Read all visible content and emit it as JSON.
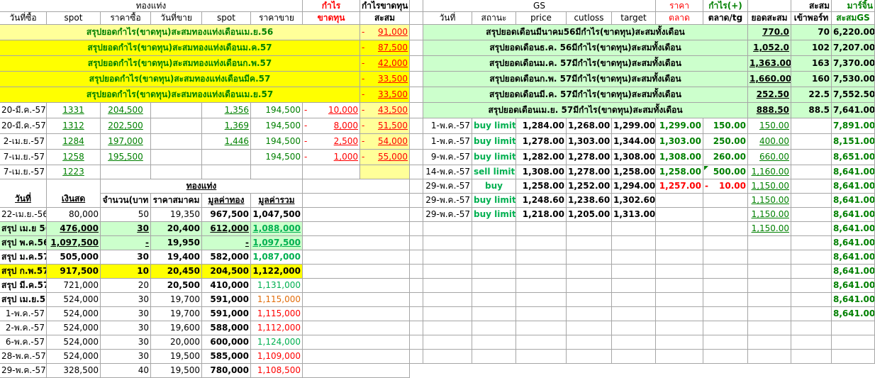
{
  "left": {
    "header1": {
      "group": "ทองแท่ง",
      "profit": "กำไร",
      "cum": "กำไรขาดทุน"
    },
    "header2": {
      "date": "วันที่ซื้อ",
      "spot1": "spot",
      "buy_price": "ราคาซื้อ",
      "sell_date": "วันที่ขาย",
      "spot2": "spot",
      "sell_price": "ราคาขาย",
      "loss": "ขาดทุน",
      "accum": "สะสม"
    },
    "summaries": [
      {
        "label": "สรุปยอดกำไร(ขาดทุน)สะสมทองแท่งเดือนเม.ย.56",
        "sign": "-",
        "value": "91,000"
      },
      {
        "label": "สรุปยอดกำไร(ขาดทุน)สะสมทองแท่งเดือนม.ค.57",
        "sign": "-",
        "value": "87,500"
      },
      {
        "label": "สรุปยอดกำไร(ขาดทุน)สะสมทองแท่งเดือนก.พ.57",
        "sign": "-",
        "value": "42,000"
      },
      {
        "label": "สรุปยอดกำไร(ขาดทุน)สะสมทองแท่งเดือนมีค.57",
        "sign": "-",
        "value": "33,500"
      },
      {
        "label": "สรุปยอดกำไร(ขาดทุน)สะสมทองแท่งเดือนเม.ย.57",
        "sign": "-",
        "value": "33,500"
      }
    ],
    "trades": [
      {
        "date": "20-มี.ค.-57",
        "spot": "1331",
        "buy": "204,500",
        "sell_date": "",
        "spot2": "1,356",
        "sell": "194,500",
        "sign": "-",
        "profit": "10,000",
        "sign2": "-",
        "accum": "43,500"
      },
      {
        "date": "20-มี.ค.-57",
        "spot": "1312",
        "buy": "202,500",
        "sell_date": "",
        "spot2": "1,369",
        "sell": "194,500",
        "sign": "-",
        "profit": "8,000",
        "sign2": "-",
        "accum": "51,500"
      },
      {
        "date": "2-เม.ย.-57",
        "spot": "1284",
        "buy": "197,000",
        "sell_date": "",
        "spot2": "1,446",
        "sell": "194,500",
        "sign": "-",
        "profit": "2,500",
        "sign2": "-",
        "accum": "54,000"
      },
      {
        "date": "7-เม.ย.-57",
        "spot": "1258",
        "buy": "195,500",
        "sell_date": "",
        "spot2": "",
        "sell": "194,500",
        "sign": "-",
        "profit": "1,000",
        "sign2": "-",
        "accum": "55,000"
      },
      {
        "date": "7-เม.ย.-57",
        "spot": "1223",
        "buy": "",
        "sell_date": "",
        "spot2": "",
        "sell": "",
        "sign": "",
        "profit": "",
        "sign2": "",
        "accum": ""
      }
    ],
    "section2": {
      "title": "ทองแท่ง",
      "headers": {
        "date": "วันที่",
        "cash": "เงินสด",
        "qty": "จำนวน(บาท",
        "assoc": "ราคาสมาคม",
        "gold_value": "มูลค่าทอง",
        "total": "มูลค่ารวม"
      },
      "rows": [
        {
          "date": "22-เม.ย.-56",
          "cash": "80,000",
          "qty": "50",
          "assoc": "19,350",
          "gold": "967,500",
          "total": "1,047,500",
          "style": "n"
        },
        {
          "date": "สรุป เม.ย 56",
          "cash": "476,000",
          "qty": "30",
          "assoc": "20,400",
          "gold": "612,000",
          "total": "1,088,000",
          "style": "green"
        },
        {
          "date": "สรุป พ.ค.56",
          "cash": "1,097,500",
          "qty": "-",
          "assoc": "19,950",
          "gold": "-",
          "total": "1,097,500",
          "style": "green"
        },
        {
          "date": "สรุป ม.ค.57",
          "cash": "505,000",
          "qty": "30",
          "assoc": "19,400",
          "gold": "582,000",
          "total": "1,087,000",
          "style": "s1"
        },
        {
          "date": "สรุป ก.พ.57",
          "cash": "917,500",
          "qty": "10",
          "assoc": "20,450",
          "gold": "204,500",
          "total": "1,122,000",
          "style": "yellow"
        },
        {
          "date": "สรุป มี.ค.57",
          "cash": "721,000",
          "qty": "20",
          "assoc": "20,500",
          "gold": "410,000",
          "total": "1,131,000",
          "style": "s2"
        },
        {
          "date": "สรุป เม.ย.57",
          "cash": "524,000",
          "qty": "30",
          "assoc": "19,700",
          "gold": "591,000",
          "total": "1,115,000",
          "style": "s3"
        },
        {
          "date": "1-พ.ค.-57",
          "cash": "524,000",
          "qty": "30",
          "assoc": "19,700",
          "gold": "591,000",
          "total": "1,115,000",
          "style": "red"
        },
        {
          "date": "2-พ.ค.-57",
          "cash": "524,000",
          "qty": "30",
          "assoc": "19,600",
          "gold": "588,000",
          "total": "1,112,000",
          "style": "red"
        },
        {
          "date": "6-พ.ค.-57",
          "cash": "524,000",
          "qty": "30",
          "assoc": "20,000",
          "gold": "600,000",
          "total": "1,124,000",
          "style": "grn"
        },
        {
          "date": "28-พ.ค.-57",
          "cash": "524,000",
          "qty": "30",
          "assoc": "19,500",
          "gold": "585,000",
          "total": "1,109,000",
          "style": "red"
        },
        {
          "date": "29-พ.ค.-57",
          "cash": "328,500",
          "qty": "40",
          "assoc": "19,500",
          "gold": "780,000",
          "total": "1,108,500",
          "style": "red"
        }
      ]
    }
  },
  "right": {
    "header1": {
      "gs": "GS",
      "price": "ราคา",
      "profit": "กำไร(+)",
      "accum": "สะสม",
      "margin": "มาร์จิ้น"
    },
    "header2": {
      "date": "วันที่",
      "status": "สถานะ",
      "price": "price",
      "cutloss": "cutloss",
      "target": "target",
      "market": "ตลาด",
      "market_tg": "ตลาด/tg",
      "total": "ยอดสะสม",
      "port": "เข้าพอร์ท",
      "accum_gs": "สะสมGS"
    },
    "summaries": [
      {
        "label": "สรุปยอดเดือนมีนาคม56มีกำไร(ขาดทุน)สะสมทั้งเดือน",
        "total": "770.0",
        "port": "70",
        "gs": "6,220.00"
      },
      {
        "label": "สรุปยอดเดือนธ.ค. 56มีกำไร(ขาดทุน)สะสมทั้งเดือน",
        "total": "1,052.0",
        "port": "102",
        "gs": "7,207.00"
      },
      {
        "label": "สรุปยอดเดือนม.ค. 57มีกำไร(ขาดทุน)สะสมทั้งเดือน",
        "total": "1,363.00",
        "port": "163",
        "gs": "7,370.00"
      },
      {
        "label": "สรุปยอดเดือนก.พ. 57มีกำไร(ขาดทุน)สะสมทั้งเดือน",
        "total": "1,660.00",
        "port": "160",
        "gs": "7,530.00"
      },
      {
        "label": "สรุปยอดเดือนมี.ค. 57มีกำไร(ขาดทุน)สะสมทั้งเดือน",
        "total": "252.50",
        "port": "22.5",
        "gs": "7,552.50"
      },
      {
        "label": "สรุปยอดเดือนเม.ย. 57มีกำไร(ขาดทุน)สะสมทั้งเดือน",
        "total": "888.50",
        "port": "88.5",
        "gs": "7,641.00"
      }
    ],
    "trades": [
      {
        "date": "1-พ.ค.-57",
        "status": "buy limit",
        "price": "1,284.00",
        "cutloss": "1,268.00",
        "target": "1,299.00",
        "market": "1,299.00",
        "sign": "",
        "profit": "150.00",
        "total": "150.00",
        "gs": "7,891.00",
        "pstyle": "g"
      },
      {
        "date": "1-พ.ค.-57",
        "status": "buy limit",
        "price": "1,278.00",
        "cutloss": "1,303.00",
        "target": "1,344.00",
        "market": "1,303.00",
        "sign": "",
        "profit": "250.00",
        "total": "400.00",
        "gs": "8,151.00",
        "pstyle": "g"
      },
      {
        "date": "9-พ.ค.-57",
        "status": "buy limit",
        "price": "1,282.00",
        "cutloss": "1,278.00",
        "target": "1,308.00",
        "market": "1,308.00",
        "sign": "",
        "profit": "260.00",
        "total": "660.00",
        "gs": "8,651.00",
        "pstyle": "g"
      },
      {
        "date": "14-พ.ค.-57",
        "status": "sell limit",
        "price": "1,308.00",
        "cutloss": "1,278.00",
        "target": "1,258.00",
        "market": "1,258.00",
        "sign": "",
        "profit": "500.00",
        "total": "1,160.00",
        "gs": "8,641.00",
        "pstyle": "g"
      },
      {
        "date": "29-พ.ค.-57",
        "status": "buy",
        "price": "1,258.00",
        "cutloss": "1,252.00",
        "target": "1,294.00",
        "market": "1,257.00",
        "sign": "-",
        "profit": "10.00",
        "total": "1,150.00",
        "gs": "8,641.00",
        "pstyle": "red"
      },
      {
        "date": "29-พ.ค.-57",
        "status": "buy limit",
        "price": "1,248.60",
        "cutloss": "1,238.60",
        "target": "1,302.60",
        "market": "",
        "sign": "",
        "profit": "",
        "total": "1,150.00",
        "gs": "8,641.00",
        "pstyle": "g"
      },
      {
        "date": "29-พ.ค.-57",
        "status": "buy limit",
        "price": "1,218.00",
        "cutloss": "1,205.00",
        "target": "1,313.00",
        "market": "",
        "sign": "",
        "profit": "",
        "total": "1,150.00",
        "gs": "8,641.00",
        "pstyle": "g"
      }
    ],
    "extra_totals": [
      "1,150.00"
    ],
    "extra_gs": [
      "8,641.00",
      "8,641.00",
      "8,641.00",
      "8,641.00",
      "8,641.00",
      "8,641.00",
      "8,641.00"
    ]
  }
}
